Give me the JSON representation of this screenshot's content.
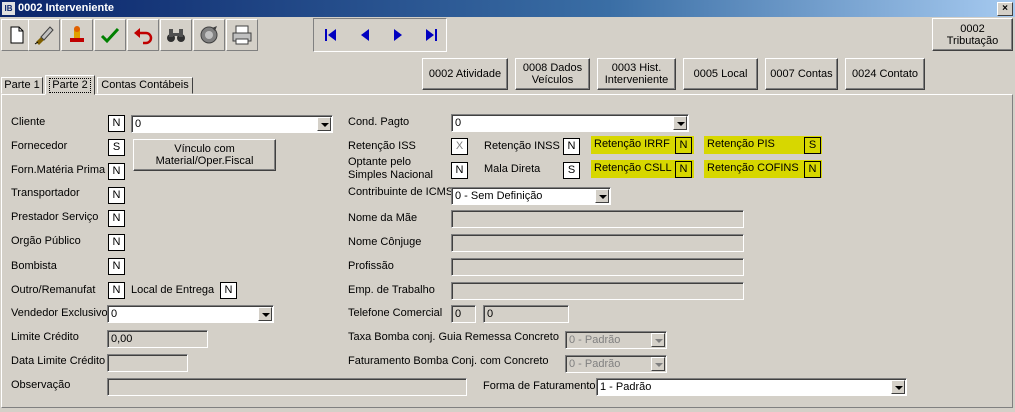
{
  "window": {
    "title": "0002 Interveniente",
    "app_icon_text": "IB",
    "close_label": "×"
  },
  "toolbar": {
    "icons": [
      "new-document-icon",
      "edit-brush-icon",
      "stamp-icon",
      "check-icon",
      "undo-icon",
      "binoculars-icon",
      "disk-icon",
      "printer-icon"
    ],
    "tributacao_label": "0002\nTributação"
  },
  "nav": {
    "first": "first-record-icon",
    "prev": "prev-record-icon",
    "next": "next-record-icon",
    "last": "last-record-icon"
  },
  "action_buttons": {
    "atividade": "0002 Atividade",
    "dados_veiculos": "0008 Dados\nVeículos",
    "hist_interveniente": "0003 Hist.\nInterveniente",
    "local": "0005 Local",
    "contas": "0007 Contas",
    "contato": "0024 Contato"
  },
  "tabs": {
    "parte1": "Parte 1",
    "parte2": "Parte 2",
    "contas_contabeis": "Contas Contábeis"
  },
  "left": {
    "cliente": {
      "label": "Cliente",
      "flag": "N",
      "value": "0"
    },
    "fornecedor": {
      "label": "Fornecedor",
      "flag": "S"
    },
    "vinculo_button": "Vínculo com\nMaterial/Oper.Fiscal",
    "forn_materia": {
      "label": "Forn.Matéria Prima",
      "flag": "N"
    },
    "transportador": {
      "label": "Transportador",
      "flag": "N"
    },
    "prestador": {
      "label": "Prestador Serviço",
      "flag": "N"
    },
    "orgao": {
      "label": "Orgão Público",
      "flag": "N"
    },
    "bombista": {
      "label": "Bombista",
      "flag": "N"
    },
    "outro": {
      "label": "Outro/Remanufat",
      "flag": "N"
    },
    "local_entrega": {
      "label": "Local de Entrega",
      "flag": "N"
    },
    "vendedor": {
      "label": "Vendedor Exclusivo",
      "value": "0"
    },
    "limite_credito": {
      "label": "Limite Crédito",
      "value": "0,00"
    },
    "data_limite": {
      "label": "Data Limite Crédito",
      "value": ""
    },
    "observacao": {
      "label": "Observação",
      "value": ""
    }
  },
  "right": {
    "cond_pagto": {
      "label": "Cond. Pagto",
      "value": "0"
    },
    "retencao_iss": {
      "label": "Retenção ISS",
      "flag": "X"
    },
    "retencao_inss": {
      "label": "Retenção INSS",
      "flag": "N"
    },
    "retencao_irrf": {
      "label": "Retenção IRRF",
      "flag": "N"
    },
    "retencao_pis": {
      "label": "Retenção PIS",
      "flag": "S"
    },
    "optante": {
      "label": "Optante pelo\nSimples Nacional",
      "flag": "N"
    },
    "mala_direta": {
      "label": "Mala Direta",
      "flag": "S"
    },
    "retencao_csll": {
      "label": "Retenção CSLL",
      "flag": "N"
    },
    "retencao_cofins": {
      "label": "Retenção COFINS",
      "flag": "N"
    },
    "contribuinte_icms": {
      "label": "Contribuinte de ICMS",
      "value": "0 - Sem Definição"
    },
    "nome_mae": {
      "label": "Nome da Mãe",
      "value": ""
    },
    "nome_conjuge": {
      "label": "Nome Cônjuge",
      "value": ""
    },
    "profissao": {
      "label": "Profissão",
      "value": ""
    },
    "emp_trabalho": {
      "label": "Emp. de Trabalho",
      "value": ""
    },
    "telefone": {
      "label": "Telefone Comercial",
      "ddd": "0",
      "numero": "0"
    },
    "taxa_bomba": {
      "label": "Taxa Bomba conj. Guia Remessa Concreto",
      "value": "0 - Padrão"
    },
    "faturamento_bomba": {
      "label": "Faturamento Bomba Conj. com Concreto",
      "value": "0 - Padrão"
    },
    "forma_faturamento": {
      "label": "Forma de Faturamento",
      "value": "1 - Padrão"
    }
  },
  "colors": {
    "highlight_yellow": "#d7d700",
    "panel_gray": "#d4d0c8",
    "title_blue": "#0a246a",
    "nav_blue": "#0000c0"
  }
}
